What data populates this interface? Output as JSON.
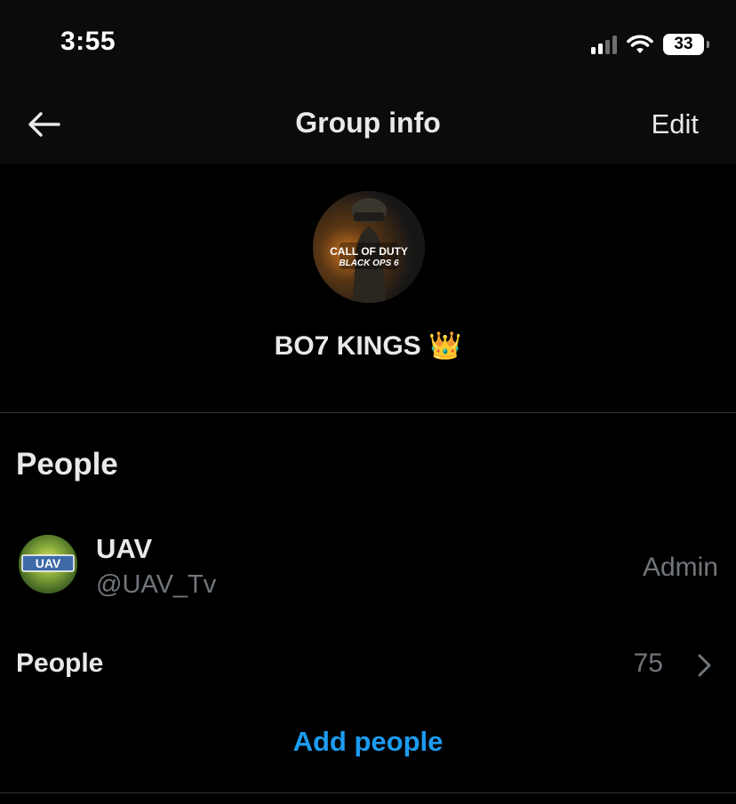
{
  "status_bar": {
    "time": "3:55",
    "battery_level": "33",
    "icons": [
      "cellular-signal-icon",
      "wifi-icon",
      "battery-icon"
    ]
  },
  "header": {
    "back_icon": "arrow-left-icon",
    "title": "Group info",
    "edit_label": "Edit"
  },
  "group": {
    "avatar_text_line1": "CALL OF DUTY",
    "avatar_text_line2": "BLACK OPS 6",
    "name": "BO7 KINGS 👑"
  },
  "people_section": {
    "title": "People",
    "members": [
      {
        "name": "UAV",
        "handle": "@UAV_Tv",
        "role": "Admin",
        "avatar_text": "UAV"
      }
    ],
    "people_row_label": "People",
    "people_count": "75",
    "chevron_icon": "chevron-right-icon",
    "add_people_label": "Add people"
  },
  "colors": {
    "background": "#000000",
    "header_background": "#0b0b0b",
    "primary_text": "#e7e9ea",
    "secondary_text": "#71767b",
    "accent_blue": "#1d9bf0",
    "divider": "#2f3336"
  }
}
